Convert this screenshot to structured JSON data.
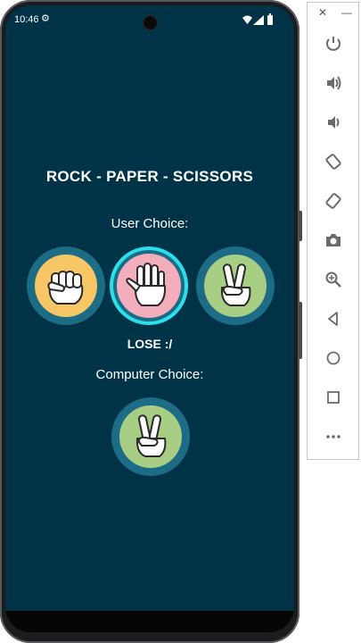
{
  "status_bar": {
    "time": "10:46"
  },
  "app": {
    "title": "ROCK - PAPER - SCISSORS",
    "user_choice_label": "User Choice:",
    "result": "LOSE :/",
    "computer_choice_label": "Computer Choice:"
  },
  "user_choices": [
    {
      "name": "rock",
      "icon": "fist-hand-icon",
      "bg": "#f7c765",
      "selected": false
    },
    {
      "name": "paper",
      "icon": "open-hand-icon",
      "bg": "#f2aebd",
      "selected": true
    },
    {
      "name": "scissors",
      "icon": "peace-hand-icon",
      "bg": "#a8ce84",
      "selected": false
    }
  ],
  "computer_choice": {
    "name": "scissors",
    "icon": "peace-hand-icon",
    "bg": "#a8ce84"
  },
  "colors": {
    "screen_bg": "#003347",
    "ring": "#1c6c86",
    "selected_ring": "#2be0e8"
  },
  "emulator_panel": {
    "top_icons": [
      "close-icon",
      "minimize-icon"
    ],
    "buttons": [
      "power-icon",
      "volume-up-icon",
      "volume-down-icon",
      "rotate-left-icon",
      "rotate-right-icon",
      "camera-icon",
      "zoom-icon",
      "back-icon",
      "home-icon",
      "overview-icon",
      "more-icon"
    ]
  }
}
